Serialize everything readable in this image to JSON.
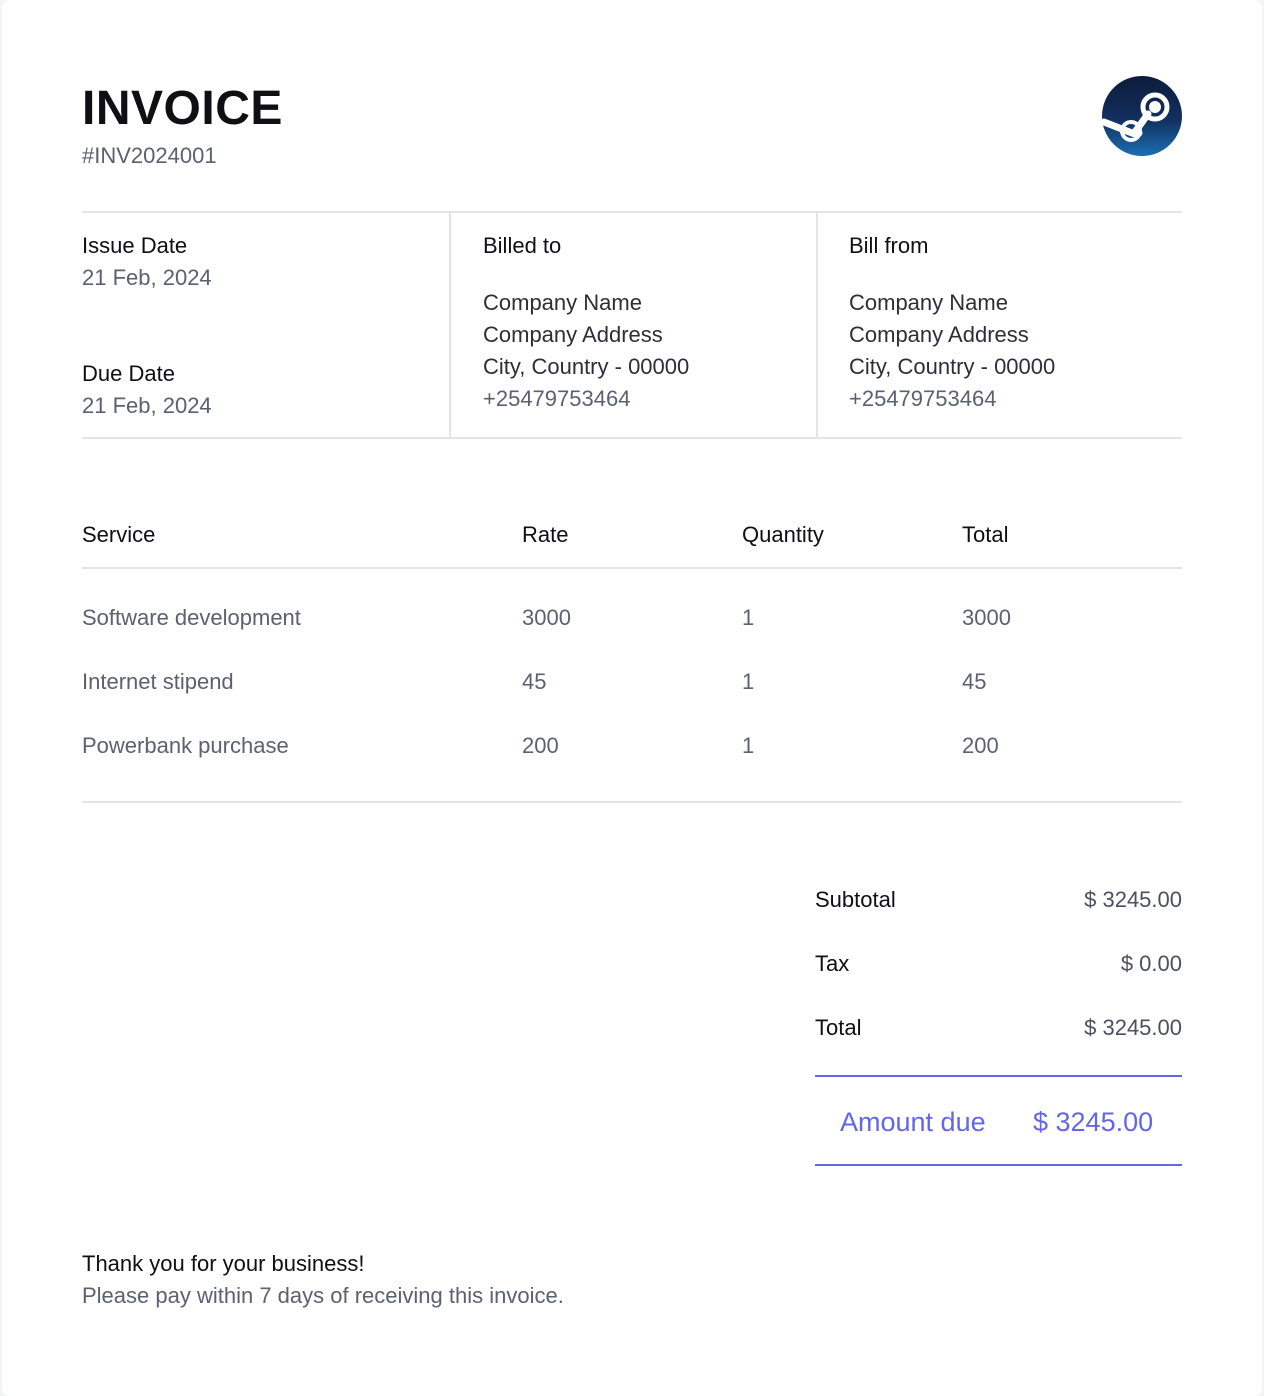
{
  "header": {
    "title": "INVOICE",
    "invoice_number": "#INV2024001",
    "logo_icon": "steam-logo-icon"
  },
  "dates": {
    "issue_label": "Issue Date",
    "issue_value": "21 Feb, 2024",
    "due_label": "Due Date",
    "due_value": "21 Feb, 2024"
  },
  "billed_to": {
    "label": "Billed to",
    "name": "Company Name",
    "address": "Company Address",
    "city": "City, Country - 00000",
    "phone": "+25479753464"
  },
  "bill_from": {
    "label": "Bill from",
    "name": "Company Name",
    "address": "Company Address",
    "city": "City, Country - 00000",
    "phone": "+25479753464"
  },
  "table": {
    "headers": [
      "Service",
      "Rate",
      "Quantity",
      "Total"
    ],
    "rows": [
      [
        "Software development",
        "3000",
        "1",
        "3000"
      ],
      [
        "Internet stipend",
        "45",
        "1",
        "45"
      ],
      [
        "Powerbank purchase",
        "200",
        "1",
        "200"
      ]
    ]
  },
  "summary": {
    "subtotal_label": "Subtotal",
    "subtotal_value": "$ 3245.00",
    "tax_label": "Tax",
    "tax_value": "$ 0.00",
    "total_label": "Total",
    "total_value": "$ 3245.00",
    "amount_due_label": "Amount due",
    "amount_due_value": "$ 3245.00"
  },
  "footer": {
    "thanks": "Thank you for your business!",
    "note": "Please pay within 7 days of receiving this invoice."
  },
  "colors": {
    "accent": "#6366e8",
    "text_primary": "#0f0f14",
    "text_secondary": "#5b6170",
    "divider": "#e3e4e8"
  }
}
